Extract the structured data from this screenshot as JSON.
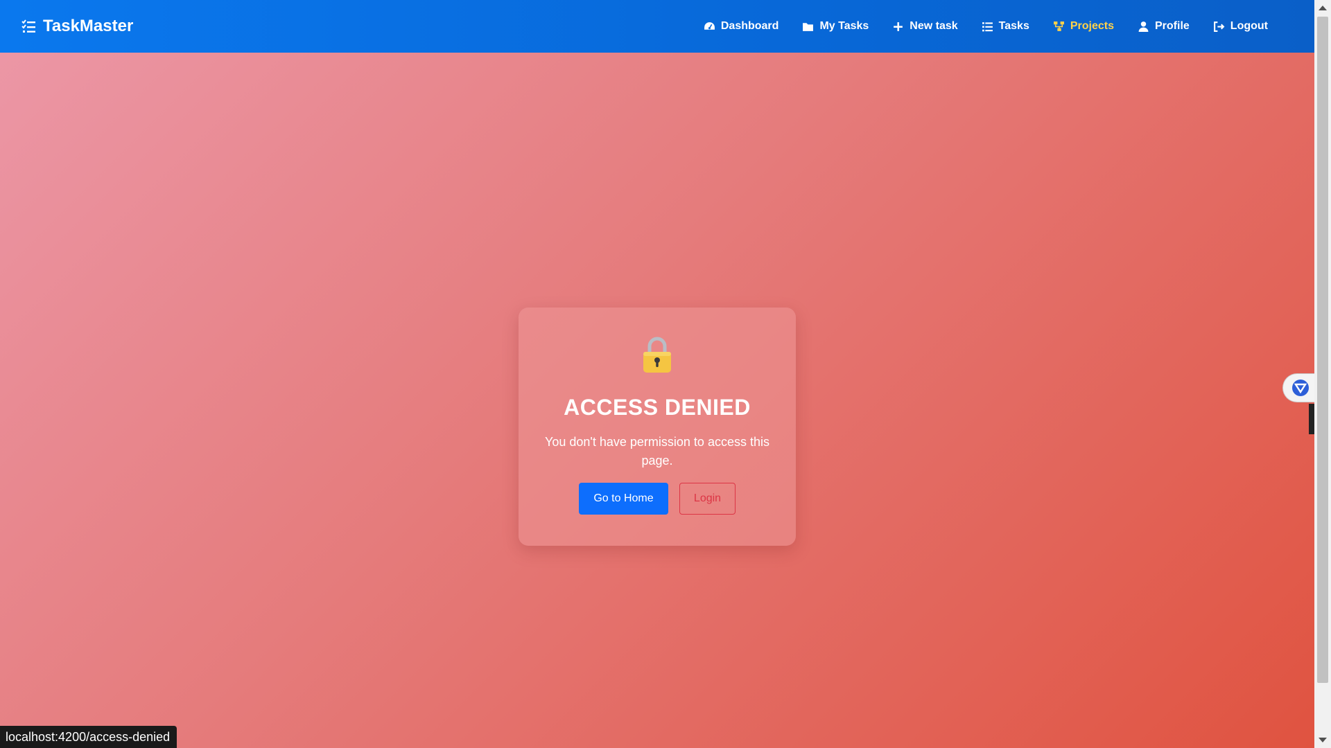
{
  "navbar": {
    "brand": "TaskMaster",
    "items": [
      {
        "label": "Dashboard",
        "icon": "gauge-icon",
        "active": false
      },
      {
        "label": "My Tasks",
        "icon": "folder-icon",
        "active": false
      },
      {
        "label": "New task",
        "icon": "plus-icon",
        "active": false
      },
      {
        "label": "Tasks",
        "icon": "list-icon",
        "active": false
      },
      {
        "label": "Projects",
        "icon": "sitemap-icon",
        "active": true
      },
      {
        "label": "Profile",
        "icon": "user-icon",
        "active": false
      },
      {
        "label": "Logout",
        "icon": "logout-icon",
        "active": false
      }
    ]
  },
  "card": {
    "icon": "lock-icon",
    "title": "ACCESS DENIED",
    "message": "You don't have permission to access this page.",
    "primary_button": "Go to Home",
    "secondary_button": "Login"
  },
  "status_bar": {
    "url": "localhost:4200/access-denied"
  },
  "colors": {
    "navbar": "#0a6fe3",
    "active_nav": "#ffd24a",
    "primary": "#0d6efd",
    "danger": "#dc3545",
    "lock_body": "#f5c542"
  }
}
